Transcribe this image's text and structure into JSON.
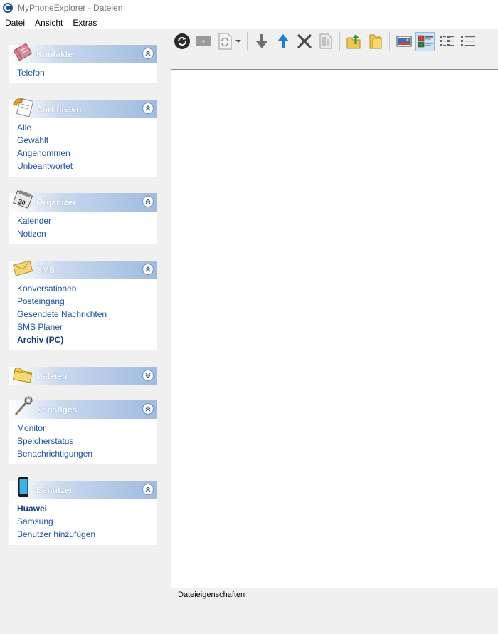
{
  "window": {
    "title": "MyPhoneExplorer -  Dateien"
  },
  "menu": [
    "Datei",
    "Ansicht",
    "Extras"
  ],
  "sidebar": {
    "kontakte": {
      "title": "Kontakte",
      "items": [
        "Telefon"
      ]
    },
    "anruflisten": {
      "title": "Anruflisten",
      "items": [
        "Alle",
        "Gewählt",
        "Angenommen",
        "Unbeantwortet"
      ]
    },
    "organizer": {
      "title": "Organizer",
      "items": [
        "Kalender",
        "Notizen"
      ]
    },
    "sms": {
      "title": "SMS",
      "items": [
        "Konversationen",
        "Posteingang",
        "Gesendete Nachrichten",
        "SMS Planer",
        "Archiv (PC)"
      ],
      "bold_item": "Archiv (PC)"
    },
    "dateien": {
      "title": "Dateien",
      "collapsed": true
    },
    "sonstiges": {
      "title": "Sonstiges",
      "items": [
        "Monitor",
        "Speicherstatus",
        "Benachrichtigungen"
      ]
    },
    "benutzer": {
      "title": "Benutzer",
      "items": [
        "Huawei",
        "Samsung",
        "Benutzer hinzufügen"
      ],
      "bold_item": "Huawei"
    }
  },
  "toolbar": {
    "buttons": [
      "refresh-icon",
      "blank-icon",
      "sync-icon",
      "dropdown-arrow-icon",
      "download-icon",
      "upload-icon",
      "delete-icon",
      "properties-icon",
      "folder-up-icon",
      "folder-icon",
      "thumbnail-view-icon",
      "tile-view-icon",
      "list-view-icon",
      "details-view-icon"
    ],
    "active": "tile-view-icon"
  },
  "properties": {
    "label": "Dateieigenschaften"
  },
  "colors": {
    "link": "#1a4f9e",
    "panel_header": "#9fbbe0",
    "selection": "#cce4f7"
  }
}
